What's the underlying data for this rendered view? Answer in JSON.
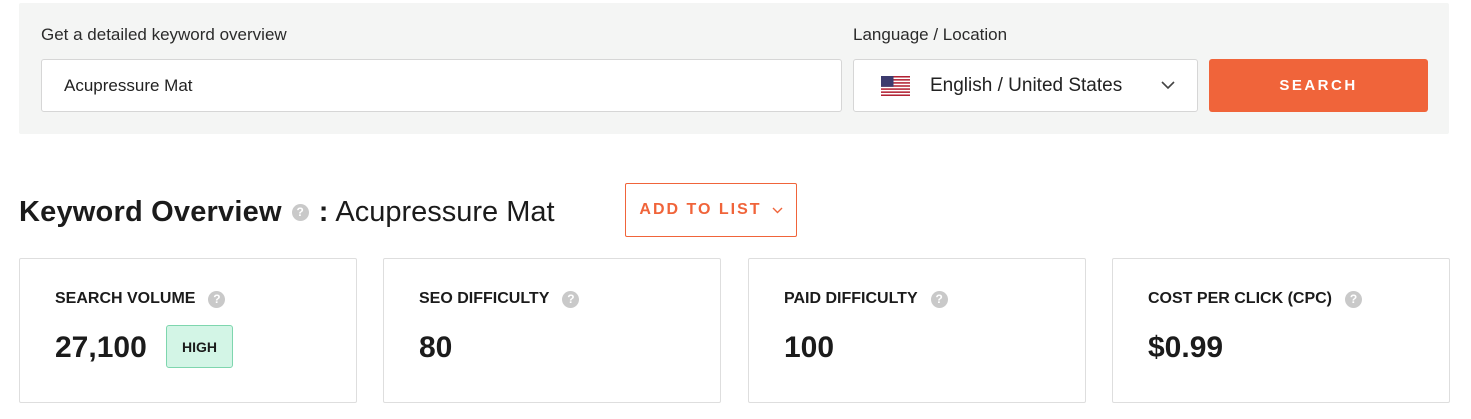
{
  "search": {
    "keyword_label": "Get a detailed keyword overview",
    "keyword_value": "Acupressure Mat",
    "language_label": "Language / Location",
    "language_value": "English / United States",
    "button_label": "SEARCH"
  },
  "overview": {
    "title": "Keyword Overview",
    "help": "?",
    "colon": ":",
    "keyword": "Acupressure Mat",
    "add_to_list_label": "ADD TO LIST"
  },
  "metrics": [
    {
      "label": "SEARCH VOLUME",
      "value": "27,100",
      "badge": "HIGH"
    },
    {
      "label": "SEO DIFFICULTY",
      "value": "80"
    },
    {
      "label": "PAID DIFFICULTY",
      "value": "100"
    },
    {
      "label": "COST PER CLICK (CPC)",
      "value": "$0.99"
    }
  ],
  "colors": {
    "accent": "#f0643a",
    "panel_bg": "#f4f5f4",
    "badge_bg": "#d3f5e6",
    "badge_border": "#7ed6ae"
  },
  "icons": {
    "flag": "us-flag-icon",
    "dropdown": "chevron-down-icon",
    "help": "help-icon"
  }
}
